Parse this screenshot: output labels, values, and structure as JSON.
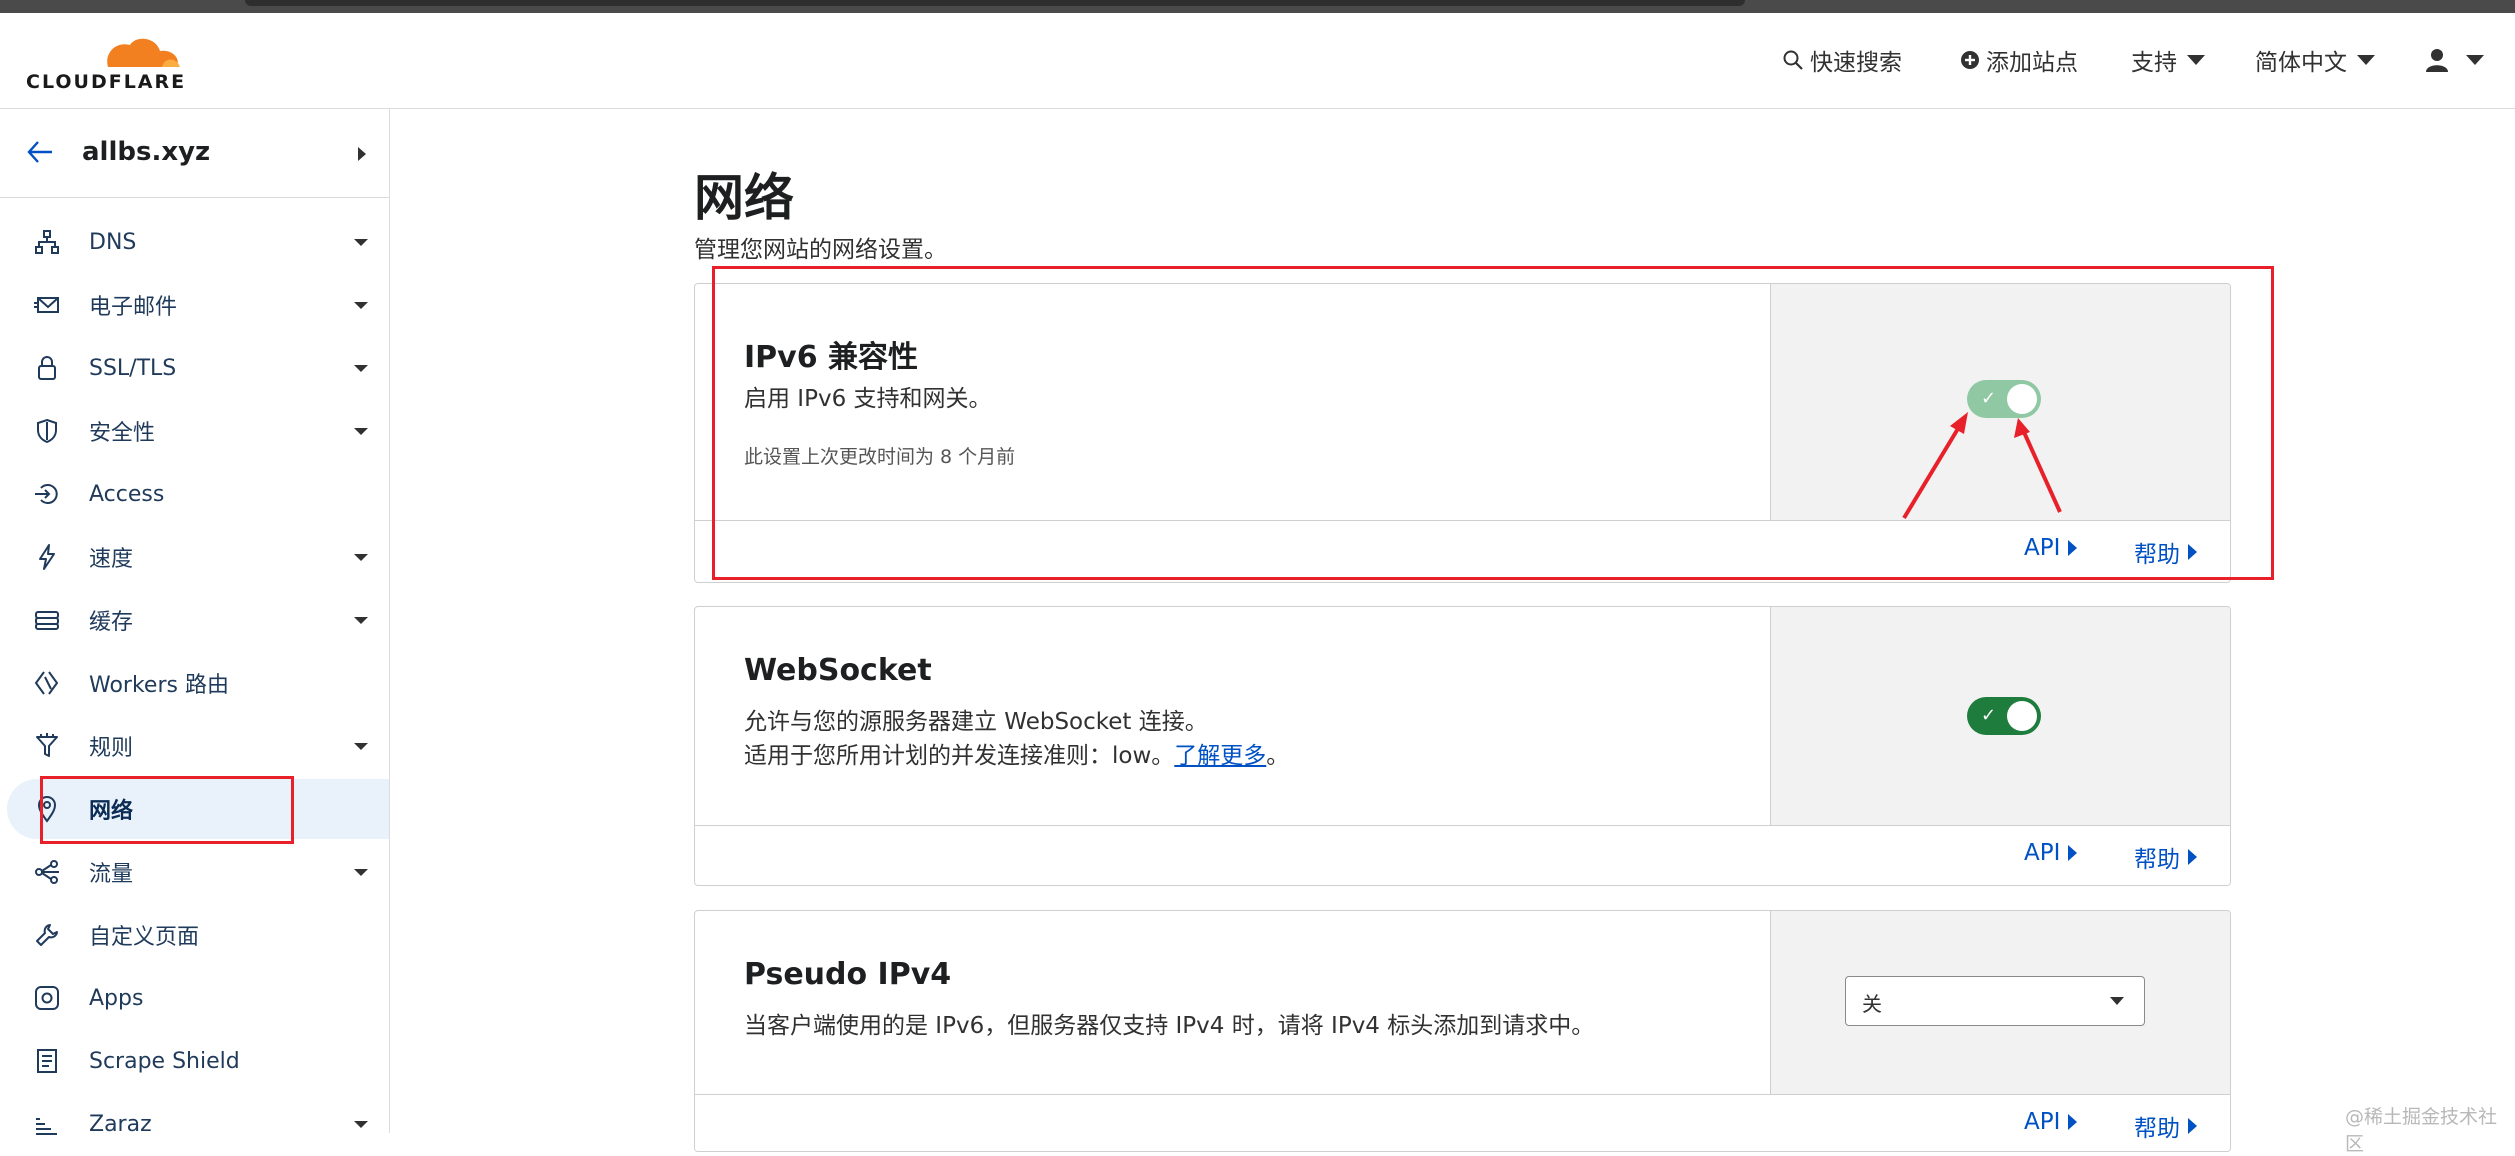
{
  "brand": {
    "name": "CLOUDFLARE",
    "cloud_color": "#f38020"
  },
  "header": {
    "search": "快速搜索",
    "add_site": "添加站点",
    "support": "支持",
    "language": "简体中文"
  },
  "sidebar": {
    "zone": "allbs.xyz",
    "items": [
      {
        "label": "DNS",
        "icon": "sitemap-icon",
        "dropdown": true
      },
      {
        "label": "电子邮件",
        "icon": "envelope-icon",
        "dropdown": true
      },
      {
        "label": "SSL/TLS",
        "icon": "lock-icon",
        "dropdown": true
      },
      {
        "label": "安全性",
        "icon": "shield-icon",
        "dropdown": true
      },
      {
        "label": "Access",
        "icon": "access-icon",
        "dropdown": false
      },
      {
        "label": "速度",
        "icon": "lightning-icon",
        "dropdown": true
      },
      {
        "label": "缓存",
        "icon": "stack-icon",
        "dropdown": true
      },
      {
        "label": "Workers 路由",
        "icon": "workers-icon",
        "dropdown": false
      },
      {
        "label": "规则",
        "icon": "funnel-icon",
        "dropdown": true
      },
      {
        "label": "网络",
        "icon": "location-pin-icon",
        "dropdown": false,
        "active": true
      },
      {
        "label": "流量",
        "icon": "share-nodes-icon",
        "dropdown": true
      },
      {
        "label": "自定义页面",
        "icon": "wrench-icon",
        "dropdown": false
      },
      {
        "label": "Apps",
        "icon": "apps-icon",
        "dropdown": false
      },
      {
        "label": "Scrape Shield",
        "icon": "document-icon",
        "dropdown": false
      },
      {
        "label": "Zaraz",
        "icon": "zaraz-icon",
        "dropdown": true
      }
    ]
  },
  "main": {
    "title": "网络",
    "subtitle": "管理您网站的网络设置。",
    "footer_api": "API",
    "footer_help": "帮助",
    "cards": {
      "ipv6": {
        "title": "IPv6 兼容性",
        "desc": "启用 IPv6 支持和网关。",
        "meta": "此设置上次更改时间为 8 个月前",
        "enabled": true,
        "toggle_color": "#8fc8a2"
      },
      "websocket": {
        "title": "WebSocket",
        "desc1": "允许与您的源服务器建立 WebSocket 连接。",
        "desc2_prefix": "适用于您所用计划的并发连接准则：low。",
        "desc2_link": "了解更多",
        "desc2_suffix": "。",
        "enabled": true,
        "toggle_color": "#1e7d3c"
      },
      "pseudo_ipv4": {
        "title": "Pseudo IPv4",
        "desc": "当客户端使用的是 IPv6，但服务器仅支持 IPv4 时，请将 IPv4 标头添加到请求中。",
        "select_value": "关"
      }
    }
  },
  "watermark": "@稀土掘金技术社区",
  "annotation_color": "#e8202a"
}
